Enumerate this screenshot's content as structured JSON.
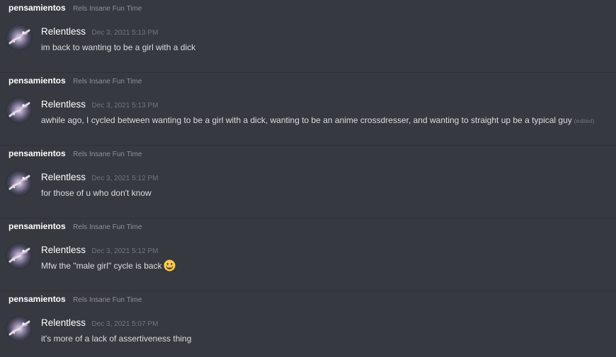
{
  "colors": {
    "background": "#36393f",
    "divider": "#2f3136",
    "channel_name": "#ffffff",
    "server_name": "#8e9297",
    "username": "#ffffff",
    "timestamp": "#72767d",
    "message": "#dcddde"
  },
  "messages": [
    {
      "channel": "pensamientos",
      "server": "Rels Insane Fun Time",
      "author": "Relentless",
      "avatar_icon": "galaxy-avatar-icon",
      "timestamp": "Dec 3, 2021 5:13 PM",
      "text": "im back to wanting to be a girl with a dick",
      "edited": ""
    },
    {
      "channel": "pensamientos",
      "server": "Rels Insane Fun Time",
      "author": "Relentless",
      "avatar_icon": "galaxy-avatar-icon",
      "timestamp": "Dec 3, 2021 5:13 PM",
      "text": "awhile ago, I cycled between wanting to be a girl with a dick, wanting to be an anime crossdresser, and wanting to straight up be a typical guy",
      "edited": "(edited)"
    },
    {
      "channel": "pensamientos",
      "server": "Rels Insane Fun Time",
      "author": "Relentless",
      "avatar_icon": "galaxy-avatar-icon",
      "timestamp": "Dec 3, 2021 5:12 PM",
      "text": "for those of u who don't know",
      "edited": ""
    },
    {
      "channel": "pensamientos",
      "server": "Rels Insane Fun Time",
      "author": "Relentless",
      "avatar_icon": "galaxy-avatar-icon",
      "timestamp": "Dec 3, 2021 5:12 PM",
      "text": "Mfw the \"male girl\" cycle is back",
      "edited": "",
      "emoji_icon": "grinning-face-emoji-icon"
    },
    {
      "channel": "pensamientos",
      "server": "Rels Insane Fun Time",
      "author": "Relentless",
      "avatar_icon": "galaxy-avatar-icon",
      "timestamp": "Dec 3, 2021 5:07 PM",
      "text": "it's more of a lack of assertiveness thing",
      "edited": ""
    }
  ]
}
